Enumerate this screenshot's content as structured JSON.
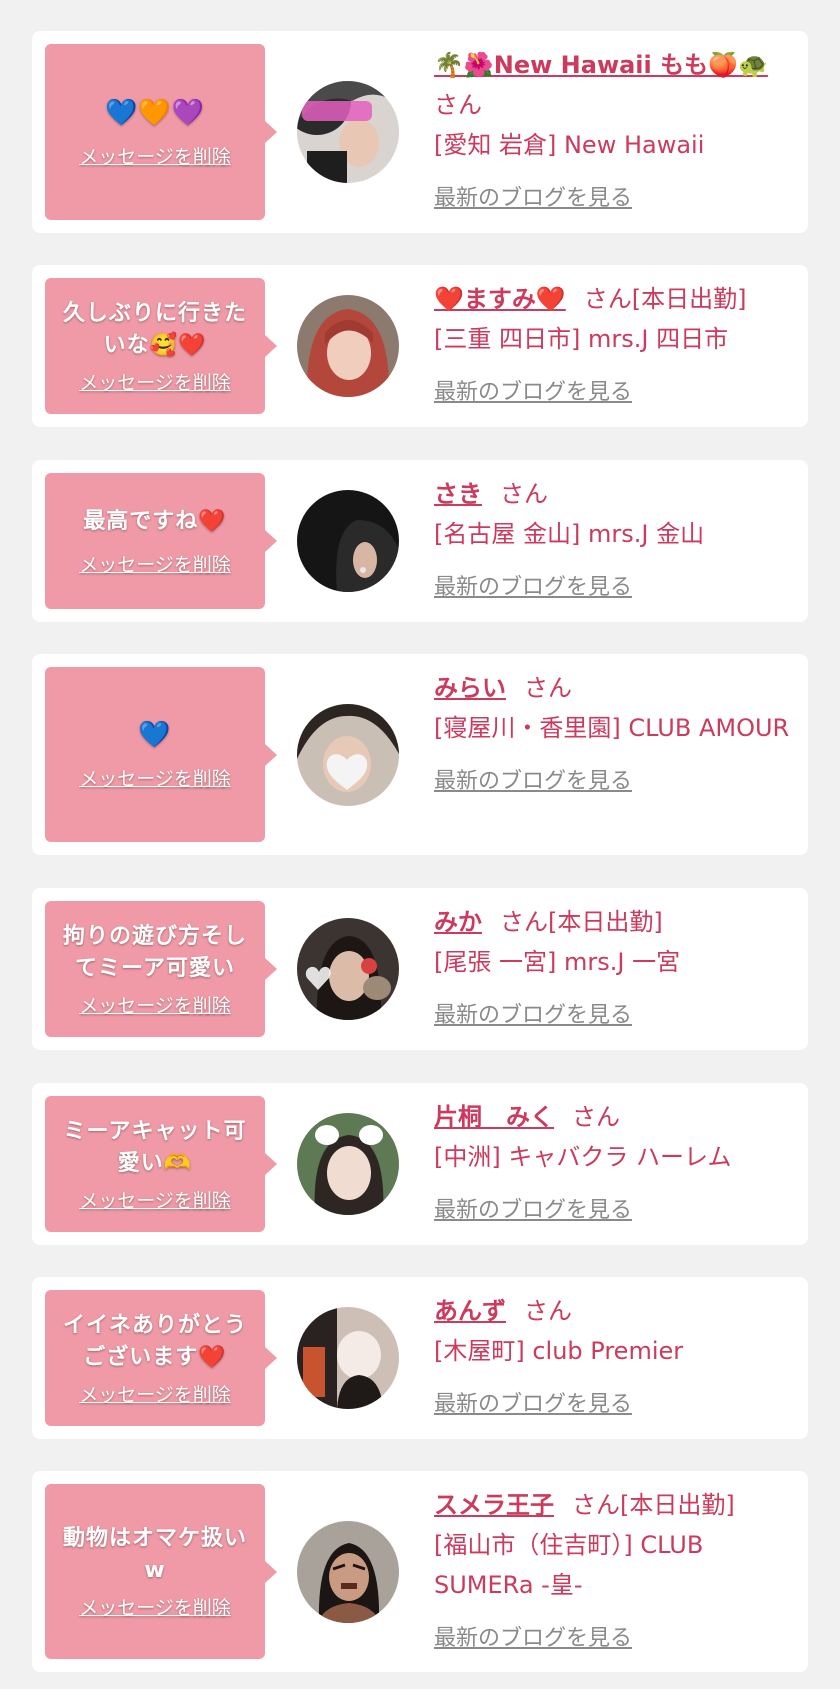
{
  "common": {
    "delete_label": "メッセージを削除",
    "blog_label": "最新のブログを見る",
    "san": "さん"
  },
  "colors": {
    "page_bg": "#f1f1f1",
    "bubble": "#ef9aa6",
    "accent": "#cc3a5d",
    "muted": "#8a8a8a"
  },
  "items": [
    {
      "message": "💙🧡💜",
      "name": "🌴🌺New Hawaii もも🍑🐢",
      "suffix": "さん",
      "shop": "[愛知 岩倉] New Hawaii"
    },
    {
      "message": "久しぶりに行きたいな🥰❤️",
      "name": "❤️ますみ❤️",
      "suffix": "さん[本日出勤]",
      "shop": "[三重 四日市] mrs.J 四日市"
    },
    {
      "message": "最高ですね❤️",
      "name": "さき",
      "suffix": "さん",
      "shop": "[名古屋 金山] mrs.J 金山"
    },
    {
      "message": "💙",
      "name": "みらい",
      "suffix": "さん",
      "shop": "[寝屋川・香里園] CLUB AMOUR"
    },
    {
      "message": "拘りの遊び方そしてミーア可愛い",
      "name": "みか",
      "suffix": "さん[本日出勤]",
      "shop": "[尾張 一宮] mrs.J 一宮"
    },
    {
      "message": "ミーアキャット可愛い🫶",
      "name": "片桐　みく",
      "suffix": "さん",
      "shop": "[中洲] キャバクラ ハーレム"
    },
    {
      "message": "イイネありがとうございます❤️",
      "name": "あんず",
      "suffix": "さん",
      "shop": "[木屋町] club Premier"
    },
    {
      "message": "動物はオマケ扱いw",
      "name": "スメラ王子",
      "suffix": "さん[本日出勤]",
      "shop": "[福山市（住吉町）] CLUB SUMERa -皇-"
    }
  ]
}
